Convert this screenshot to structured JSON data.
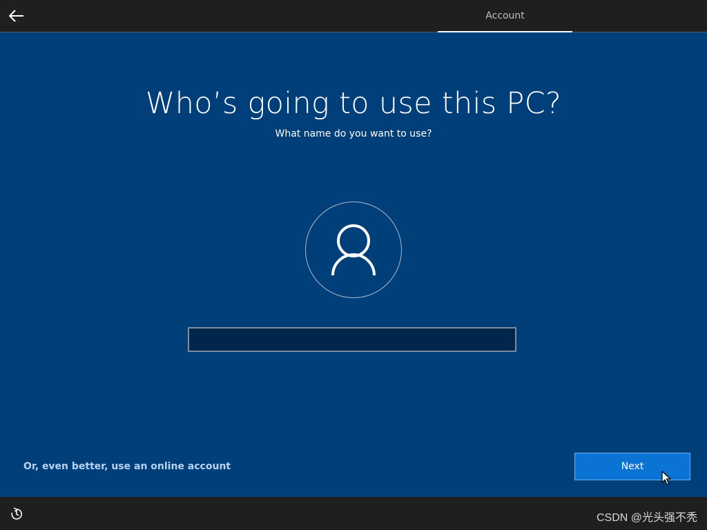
{
  "header": {
    "back_icon": "back-arrow-icon",
    "active_tab": "Account"
  },
  "main": {
    "title": "Who’s going to use this PC?",
    "subtitle": "What name do you want to use?",
    "avatar_icon": "user-icon",
    "name_input": {
      "value": "",
      "placeholder": ""
    },
    "online_account_link": "Or, even better, use an online account",
    "next_button": "Next"
  },
  "footer": {
    "accessibility_icon": "ease-of-access-icon",
    "watermark": "CSDN @光头强不秃"
  },
  "colors": {
    "background": "#003f79",
    "bars": "#1f1f1f",
    "accent": "#0b73d4",
    "input_bg": "#00264b"
  }
}
